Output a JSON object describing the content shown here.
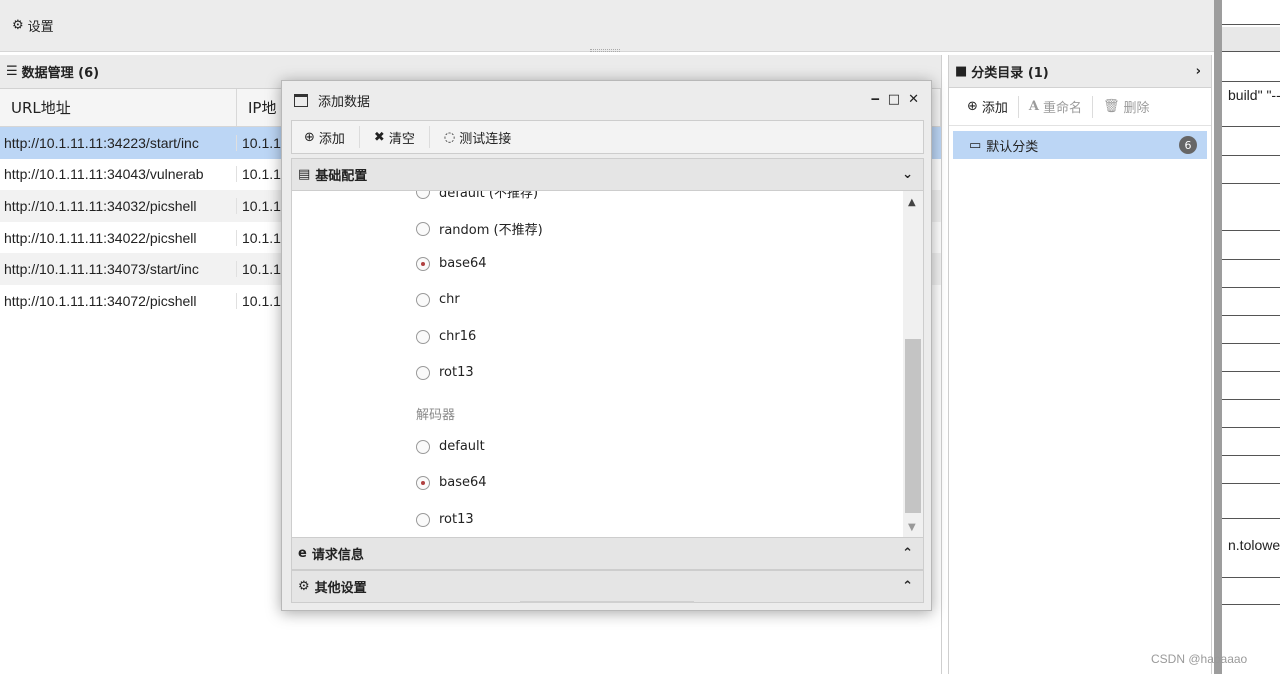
{
  "topbar": {
    "settings_label": "设置"
  },
  "left_panel": {
    "title": "数据管理 (6)",
    "columns": [
      "URL地址",
      "IP地"
    ],
    "rows": [
      {
        "url": "http://10.1.11.11:34223/start/inc",
        "ip": "10.1.1"
      },
      {
        "url": "http://10.1.11.11:34043/vulnerab",
        "ip": "10.1.1"
      },
      {
        "url": "http://10.1.11.11:34032/picshell",
        "ip": "10.1.1"
      },
      {
        "url": "http://10.1.11.11:34022/picshell",
        "ip": "10.1.1"
      },
      {
        "url": "http://10.1.11.11:34073/start/inc",
        "ip": "10.1.1"
      },
      {
        "url": "http://10.1.11.11:34072/picshell",
        "ip": "10.1.1"
      }
    ]
  },
  "right_panel": {
    "title": "分类目录 (1)",
    "toolbar": {
      "add": "添加",
      "rename": "重命名",
      "delete": "删除"
    },
    "category": {
      "name": "默认分类",
      "count": "6"
    }
  },
  "strip": {
    "text1": "build\" \"--",
    "text2": "n.tolower"
  },
  "dialog": {
    "title": "添加数据",
    "toolbar": {
      "add": "添加",
      "clear": "清空",
      "test": "测试连接"
    },
    "section_basic": "基础配置",
    "encoder_options": [
      {
        "label": "default (不推荐)",
        "checked": false
      },
      {
        "label": "random (不推荐)",
        "checked": false
      },
      {
        "label": "base64",
        "checked": true
      },
      {
        "label": "chr",
        "checked": false
      },
      {
        "label": "chr16",
        "checked": false
      },
      {
        "label": "rot13",
        "checked": false
      }
    ],
    "decoder_label": "解码器",
    "decoder_options": [
      {
        "label": "default",
        "checked": false
      },
      {
        "label": "base64",
        "checked": true
      },
      {
        "label": "rot13",
        "checked": false
      }
    ],
    "section_request": "请求信息",
    "section_other": "其他设置"
  },
  "watermark": "CSDN @haoaaao"
}
